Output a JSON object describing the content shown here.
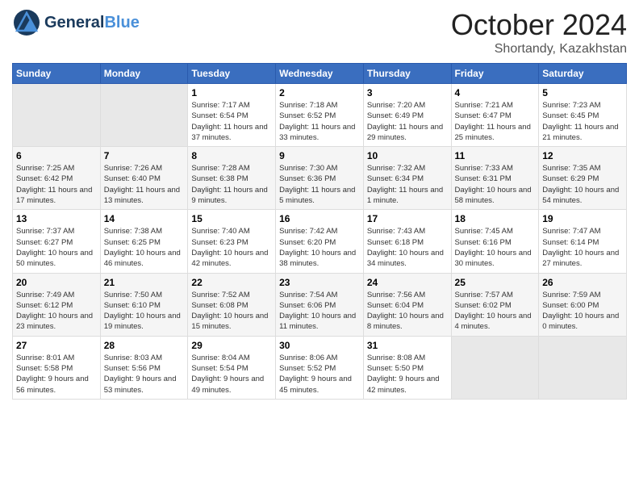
{
  "header": {
    "logo_general": "General",
    "logo_blue": "Blue",
    "month": "October 2024",
    "location": "Shortandy, Kazakhstan"
  },
  "days_of_week": [
    "Sunday",
    "Monday",
    "Tuesday",
    "Wednesday",
    "Thursday",
    "Friday",
    "Saturday"
  ],
  "weeks": [
    {
      "cells": [
        {
          "empty": true
        },
        {
          "empty": true
        },
        {
          "day": 1,
          "sunrise": "Sunrise: 7:17 AM",
          "sunset": "Sunset: 6:54 PM",
          "daylight": "Daylight: 11 hours and 37 minutes."
        },
        {
          "day": 2,
          "sunrise": "Sunrise: 7:18 AM",
          "sunset": "Sunset: 6:52 PM",
          "daylight": "Daylight: 11 hours and 33 minutes."
        },
        {
          "day": 3,
          "sunrise": "Sunrise: 7:20 AM",
          "sunset": "Sunset: 6:49 PM",
          "daylight": "Daylight: 11 hours and 29 minutes."
        },
        {
          "day": 4,
          "sunrise": "Sunrise: 7:21 AM",
          "sunset": "Sunset: 6:47 PM",
          "daylight": "Daylight: 11 hours and 25 minutes."
        },
        {
          "day": 5,
          "sunrise": "Sunrise: 7:23 AM",
          "sunset": "Sunset: 6:45 PM",
          "daylight": "Daylight: 11 hours and 21 minutes."
        }
      ]
    },
    {
      "cells": [
        {
          "day": 6,
          "sunrise": "Sunrise: 7:25 AM",
          "sunset": "Sunset: 6:42 PM",
          "daylight": "Daylight: 11 hours and 17 minutes."
        },
        {
          "day": 7,
          "sunrise": "Sunrise: 7:26 AM",
          "sunset": "Sunset: 6:40 PM",
          "daylight": "Daylight: 11 hours and 13 minutes."
        },
        {
          "day": 8,
          "sunrise": "Sunrise: 7:28 AM",
          "sunset": "Sunset: 6:38 PM",
          "daylight": "Daylight: 11 hours and 9 minutes."
        },
        {
          "day": 9,
          "sunrise": "Sunrise: 7:30 AM",
          "sunset": "Sunset: 6:36 PM",
          "daylight": "Daylight: 11 hours and 5 minutes."
        },
        {
          "day": 10,
          "sunrise": "Sunrise: 7:32 AM",
          "sunset": "Sunset: 6:34 PM",
          "daylight": "Daylight: 11 hours and 1 minute."
        },
        {
          "day": 11,
          "sunrise": "Sunrise: 7:33 AM",
          "sunset": "Sunset: 6:31 PM",
          "daylight": "Daylight: 10 hours and 58 minutes."
        },
        {
          "day": 12,
          "sunrise": "Sunrise: 7:35 AM",
          "sunset": "Sunset: 6:29 PM",
          "daylight": "Daylight: 10 hours and 54 minutes."
        }
      ]
    },
    {
      "cells": [
        {
          "day": 13,
          "sunrise": "Sunrise: 7:37 AM",
          "sunset": "Sunset: 6:27 PM",
          "daylight": "Daylight: 10 hours and 50 minutes."
        },
        {
          "day": 14,
          "sunrise": "Sunrise: 7:38 AM",
          "sunset": "Sunset: 6:25 PM",
          "daylight": "Daylight: 10 hours and 46 minutes."
        },
        {
          "day": 15,
          "sunrise": "Sunrise: 7:40 AM",
          "sunset": "Sunset: 6:23 PM",
          "daylight": "Daylight: 10 hours and 42 minutes."
        },
        {
          "day": 16,
          "sunrise": "Sunrise: 7:42 AM",
          "sunset": "Sunset: 6:20 PM",
          "daylight": "Daylight: 10 hours and 38 minutes."
        },
        {
          "day": 17,
          "sunrise": "Sunrise: 7:43 AM",
          "sunset": "Sunset: 6:18 PM",
          "daylight": "Daylight: 10 hours and 34 minutes."
        },
        {
          "day": 18,
          "sunrise": "Sunrise: 7:45 AM",
          "sunset": "Sunset: 6:16 PM",
          "daylight": "Daylight: 10 hours and 30 minutes."
        },
        {
          "day": 19,
          "sunrise": "Sunrise: 7:47 AM",
          "sunset": "Sunset: 6:14 PM",
          "daylight": "Daylight: 10 hours and 27 minutes."
        }
      ]
    },
    {
      "cells": [
        {
          "day": 20,
          "sunrise": "Sunrise: 7:49 AM",
          "sunset": "Sunset: 6:12 PM",
          "daylight": "Daylight: 10 hours and 23 minutes."
        },
        {
          "day": 21,
          "sunrise": "Sunrise: 7:50 AM",
          "sunset": "Sunset: 6:10 PM",
          "daylight": "Daylight: 10 hours and 19 minutes."
        },
        {
          "day": 22,
          "sunrise": "Sunrise: 7:52 AM",
          "sunset": "Sunset: 6:08 PM",
          "daylight": "Daylight: 10 hours and 15 minutes."
        },
        {
          "day": 23,
          "sunrise": "Sunrise: 7:54 AM",
          "sunset": "Sunset: 6:06 PM",
          "daylight": "Daylight: 10 hours and 11 minutes."
        },
        {
          "day": 24,
          "sunrise": "Sunrise: 7:56 AM",
          "sunset": "Sunset: 6:04 PM",
          "daylight": "Daylight: 10 hours and 8 minutes."
        },
        {
          "day": 25,
          "sunrise": "Sunrise: 7:57 AM",
          "sunset": "Sunset: 6:02 PM",
          "daylight": "Daylight: 10 hours and 4 minutes."
        },
        {
          "day": 26,
          "sunrise": "Sunrise: 7:59 AM",
          "sunset": "Sunset: 6:00 PM",
          "daylight": "Daylight: 10 hours and 0 minutes."
        }
      ]
    },
    {
      "cells": [
        {
          "day": 27,
          "sunrise": "Sunrise: 8:01 AM",
          "sunset": "Sunset: 5:58 PM",
          "daylight": "Daylight: 9 hours and 56 minutes."
        },
        {
          "day": 28,
          "sunrise": "Sunrise: 8:03 AM",
          "sunset": "Sunset: 5:56 PM",
          "daylight": "Daylight: 9 hours and 53 minutes."
        },
        {
          "day": 29,
          "sunrise": "Sunrise: 8:04 AM",
          "sunset": "Sunset: 5:54 PM",
          "daylight": "Daylight: 9 hours and 49 minutes."
        },
        {
          "day": 30,
          "sunrise": "Sunrise: 8:06 AM",
          "sunset": "Sunset: 5:52 PM",
          "daylight": "Daylight: 9 hours and 45 minutes."
        },
        {
          "day": 31,
          "sunrise": "Sunrise: 8:08 AM",
          "sunset": "Sunset: 5:50 PM",
          "daylight": "Daylight: 9 hours and 42 minutes."
        },
        {
          "empty": true
        },
        {
          "empty": true
        }
      ]
    }
  ]
}
